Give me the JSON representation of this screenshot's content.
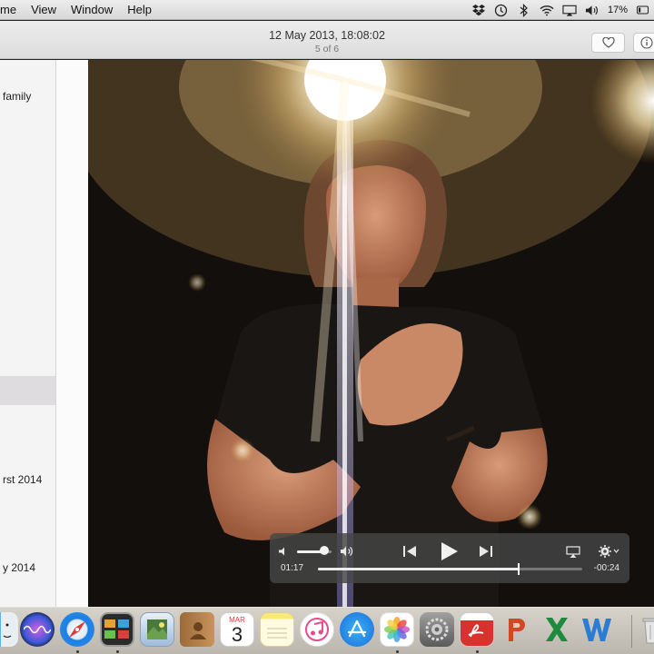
{
  "menubar": {
    "items": [
      "me",
      "View",
      "Window",
      "Help"
    ],
    "battery": "17%"
  },
  "window": {
    "title_date": "12 May 2013, 18:08:02",
    "title_count": "5 of 6"
  },
  "sidebar": {
    "items": [
      "family",
      "rst 2014",
      "y 2014"
    ]
  },
  "video": {
    "elapsed": "01:17",
    "remaining": "-00:24",
    "volume_fraction": 0.8,
    "progress_fraction": 0.76
  },
  "dock": {
    "calendar_month": "MAR",
    "calendar_day": "3",
    "icons": [
      "finder-icon",
      "siri-icon",
      "safari-icon",
      "photo-booth-icon",
      "preview-icon",
      "contacts-icon",
      "calendar-icon",
      "notes-icon",
      "itunes-icon",
      "app-store-icon",
      "photos-icon",
      "system-preferences-icon",
      "acrobat-icon",
      "powerpoint-icon",
      "excel-icon",
      "word-icon",
      "trash-icon"
    ]
  }
}
